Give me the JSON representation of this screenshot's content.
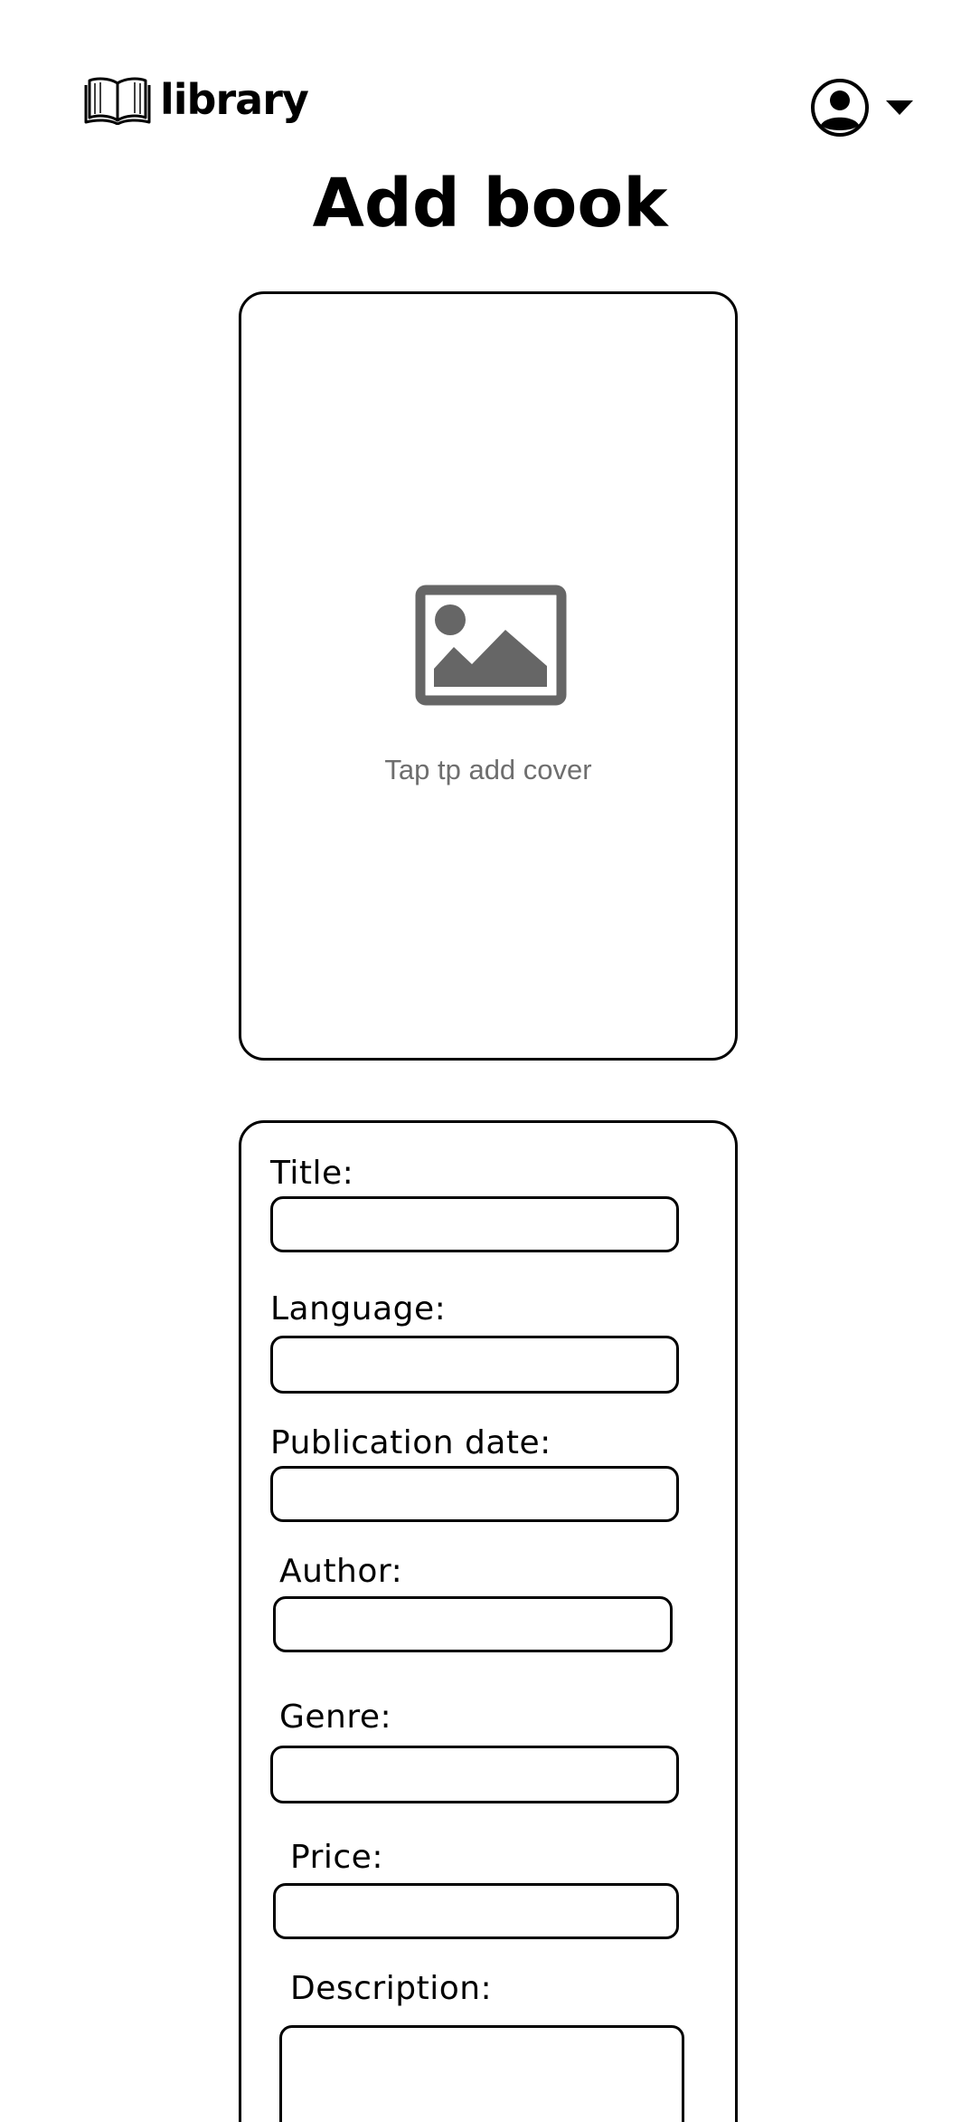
{
  "header": {
    "logo_text": "library",
    "logo_icon": "open-book-icon",
    "account_icon": "user-circle-icon",
    "menu_icon": "caret-down-icon"
  },
  "page": {
    "title": "Add book"
  },
  "cover": {
    "icon": "image-placeholder-icon",
    "hint": "Tap tp add cover"
  },
  "form": {
    "fields": [
      {
        "label": "Title:",
        "value": ""
      },
      {
        "label": "Language:",
        "value": ""
      },
      {
        "label": "Publication date:",
        "value": ""
      },
      {
        "label": "Author:",
        "value": ""
      },
      {
        "label": "Genre:",
        "value": ""
      },
      {
        "label": "Price:",
        "value": ""
      },
      {
        "label": "Description:",
        "value": ""
      }
    ]
  },
  "colors": {
    "text": "#000000",
    "hint": "#6e6e6e",
    "icon_fill": "#666666",
    "background": "#ffffff"
  }
}
